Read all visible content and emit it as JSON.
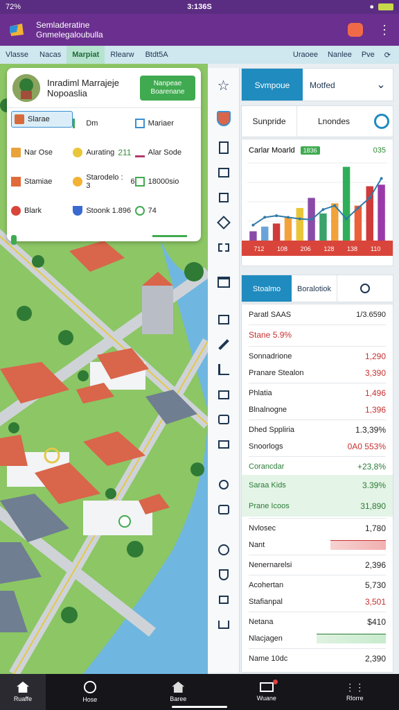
{
  "status_bar": {
    "left": "72%",
    "time": "3:136S"
  },
  "app": {
    "title_line1": "Semladeratine",
    "title_line2": "Gnmelegaloubulla"
  },
  "top_tabs": {
    "items": [
      "Vlasse",
      "Nacas",
      "Marpiat",
      "Rlearw",
      "Btdt5A"
    ],
    "right": [
      "Uraoee",
      "Nanlee",
      "Pve"
    ]
  },
  "info_card": {
    "title_line1": "Inradiml Marrajeje",
    "title_line2": "Nopoaslia",
    "stat_line1": "Nanpeae",
    "stat_line2": "Boarenane",
    "cells": [
      {
        "label": "Slarae",
        "value": ""
      },
      {
        "label": "Dm",
        "value": ""
      },
      {
        "label": "Mariaer",
        "value": ""
      },
      {
        "label": "Nar Ose",
        "value": ""
      },
      {
        "label": "Aurating",
        "value": "211"
      },
      {
        "label": "Alar Sode",
        "value": ""
      },
      {
        "label": "Stamiae",
        "value": ""
      },
      {
        "label": "Starodelo : 3",
        "value": "6"
      },
      {
        "label": "18000sio",
        "value": ""
      },
      {
        "label": "Blark",
        "value": ""
      },
      {
        "label": "Stoonk 1.896",
        "value": ""
      },
      {
        "label": "74",
        "value": ""
      },
      {
        "label": "",
        "value": ""
      }
    ]
  },
  "right_top": {
    "tab_active": "Svmpoue",
    "tab_other": "Motfed"
  },
  "right_seg": {
    "a": "Sunpride",
    "b": "Lnondes"
  },
  "chart_data": {
    "type": "bar",
    "title": "Carlar Moarld",
    "badge": "1836",
    "pct": "035",
    "xlabel": "",
    "ylabel": "",
    "categories": [
      "c1",
      "c2",
      "c3",
      "c4",
      "c5",
      "c6",
      "c7",
      "c8",
      "c9",
      "c10",
      "c11",
      "c12"
    ],
    "values": [
      12,
      18,
      22,
      30,
      42,
      55,
      35,
      48,
      95,
      45,
      70,
      72
    ],
    "bar_colors": [
      "#8a4aa8",
      "#6aa3d8",
      "#cf3a3a",
      "#f2a23a",
      "#e9c53a",
      "#8a4aa8",
      "#3aa36a",
      "#f2a23a",
      "#2fae59",
      "#e9603a",
      "#cf3a3a",
      "#9a3aa8"
    ],
    "line": [
      20,
      30,
      32,
      30,
      28,
      27,
      40,
      45,
      28,
      42,
      55,
      80
    ],
    "xticks": [
      "712",
      "108",
      "206",
      "128",
      "138",
      "110"
    ],
    "ylim": [
      0,
      100
    ]
  },
  "mid_tabs": {
    "a": "Stoalmo",
    "b": "Boralotiok"
  },
  "list": {
    "header": {
      "label": "Paratl SAAS",
      "value": "1/3.6590"
    },
    "sub": {
      "label": "Stane 5.9%"
    },
    "rows": [
      {
        "label": "Sonnadrione",
        "value": "1,290"
      },
      {
        "label": "Pranare Stealon",
        "value": "3,390"
      },
      {
        "label": "Phlatia",
        "value": "1,496"
      },
      {
        "label": "Blnalnogne",
        "value": "1,396"
      },
      {
        "label": "Dhed Sppliria",
        "value": "1.3,39%"
      },
      {
        "label": "Snoorlogs",
        "value": "0A0 553%"
      },
      {
        "label": "Corancdar",
        "value": "+23,8%"
      },
      {
        "label": "Saraa Kids",
        "value": "3.39%"
      },
      {
        "label": "Prane Icoos",
        "value": "31,890"
      },
      {
        "label": "Nvlosec",
        "value": "1,780"
      },
      {
        "label": "Nant",
        "value": ""
      },
      {
        "label": "Nenernarelsi",
        "value": "2,396"
      },
      {
        "label": "Acohertan",
        "value": "5,730"
      },
      {
        "label": "Stafianpal",
        "value": "3,501"
      },
      {
        "label": "Netana",
        "value": "$410"
      },
      {
        "label": "Nlacjagen",
        "value": ""
      },
      {
        "label": "Name 10dc",
        "value": "2,390"
      }
    ]
  },
  "bottom_nav": {
    "items": [
      "Ruaffe",
      "Hose",
      "Baree",
      "Wuane",
      "Rlorre"
    ]
  }
}
